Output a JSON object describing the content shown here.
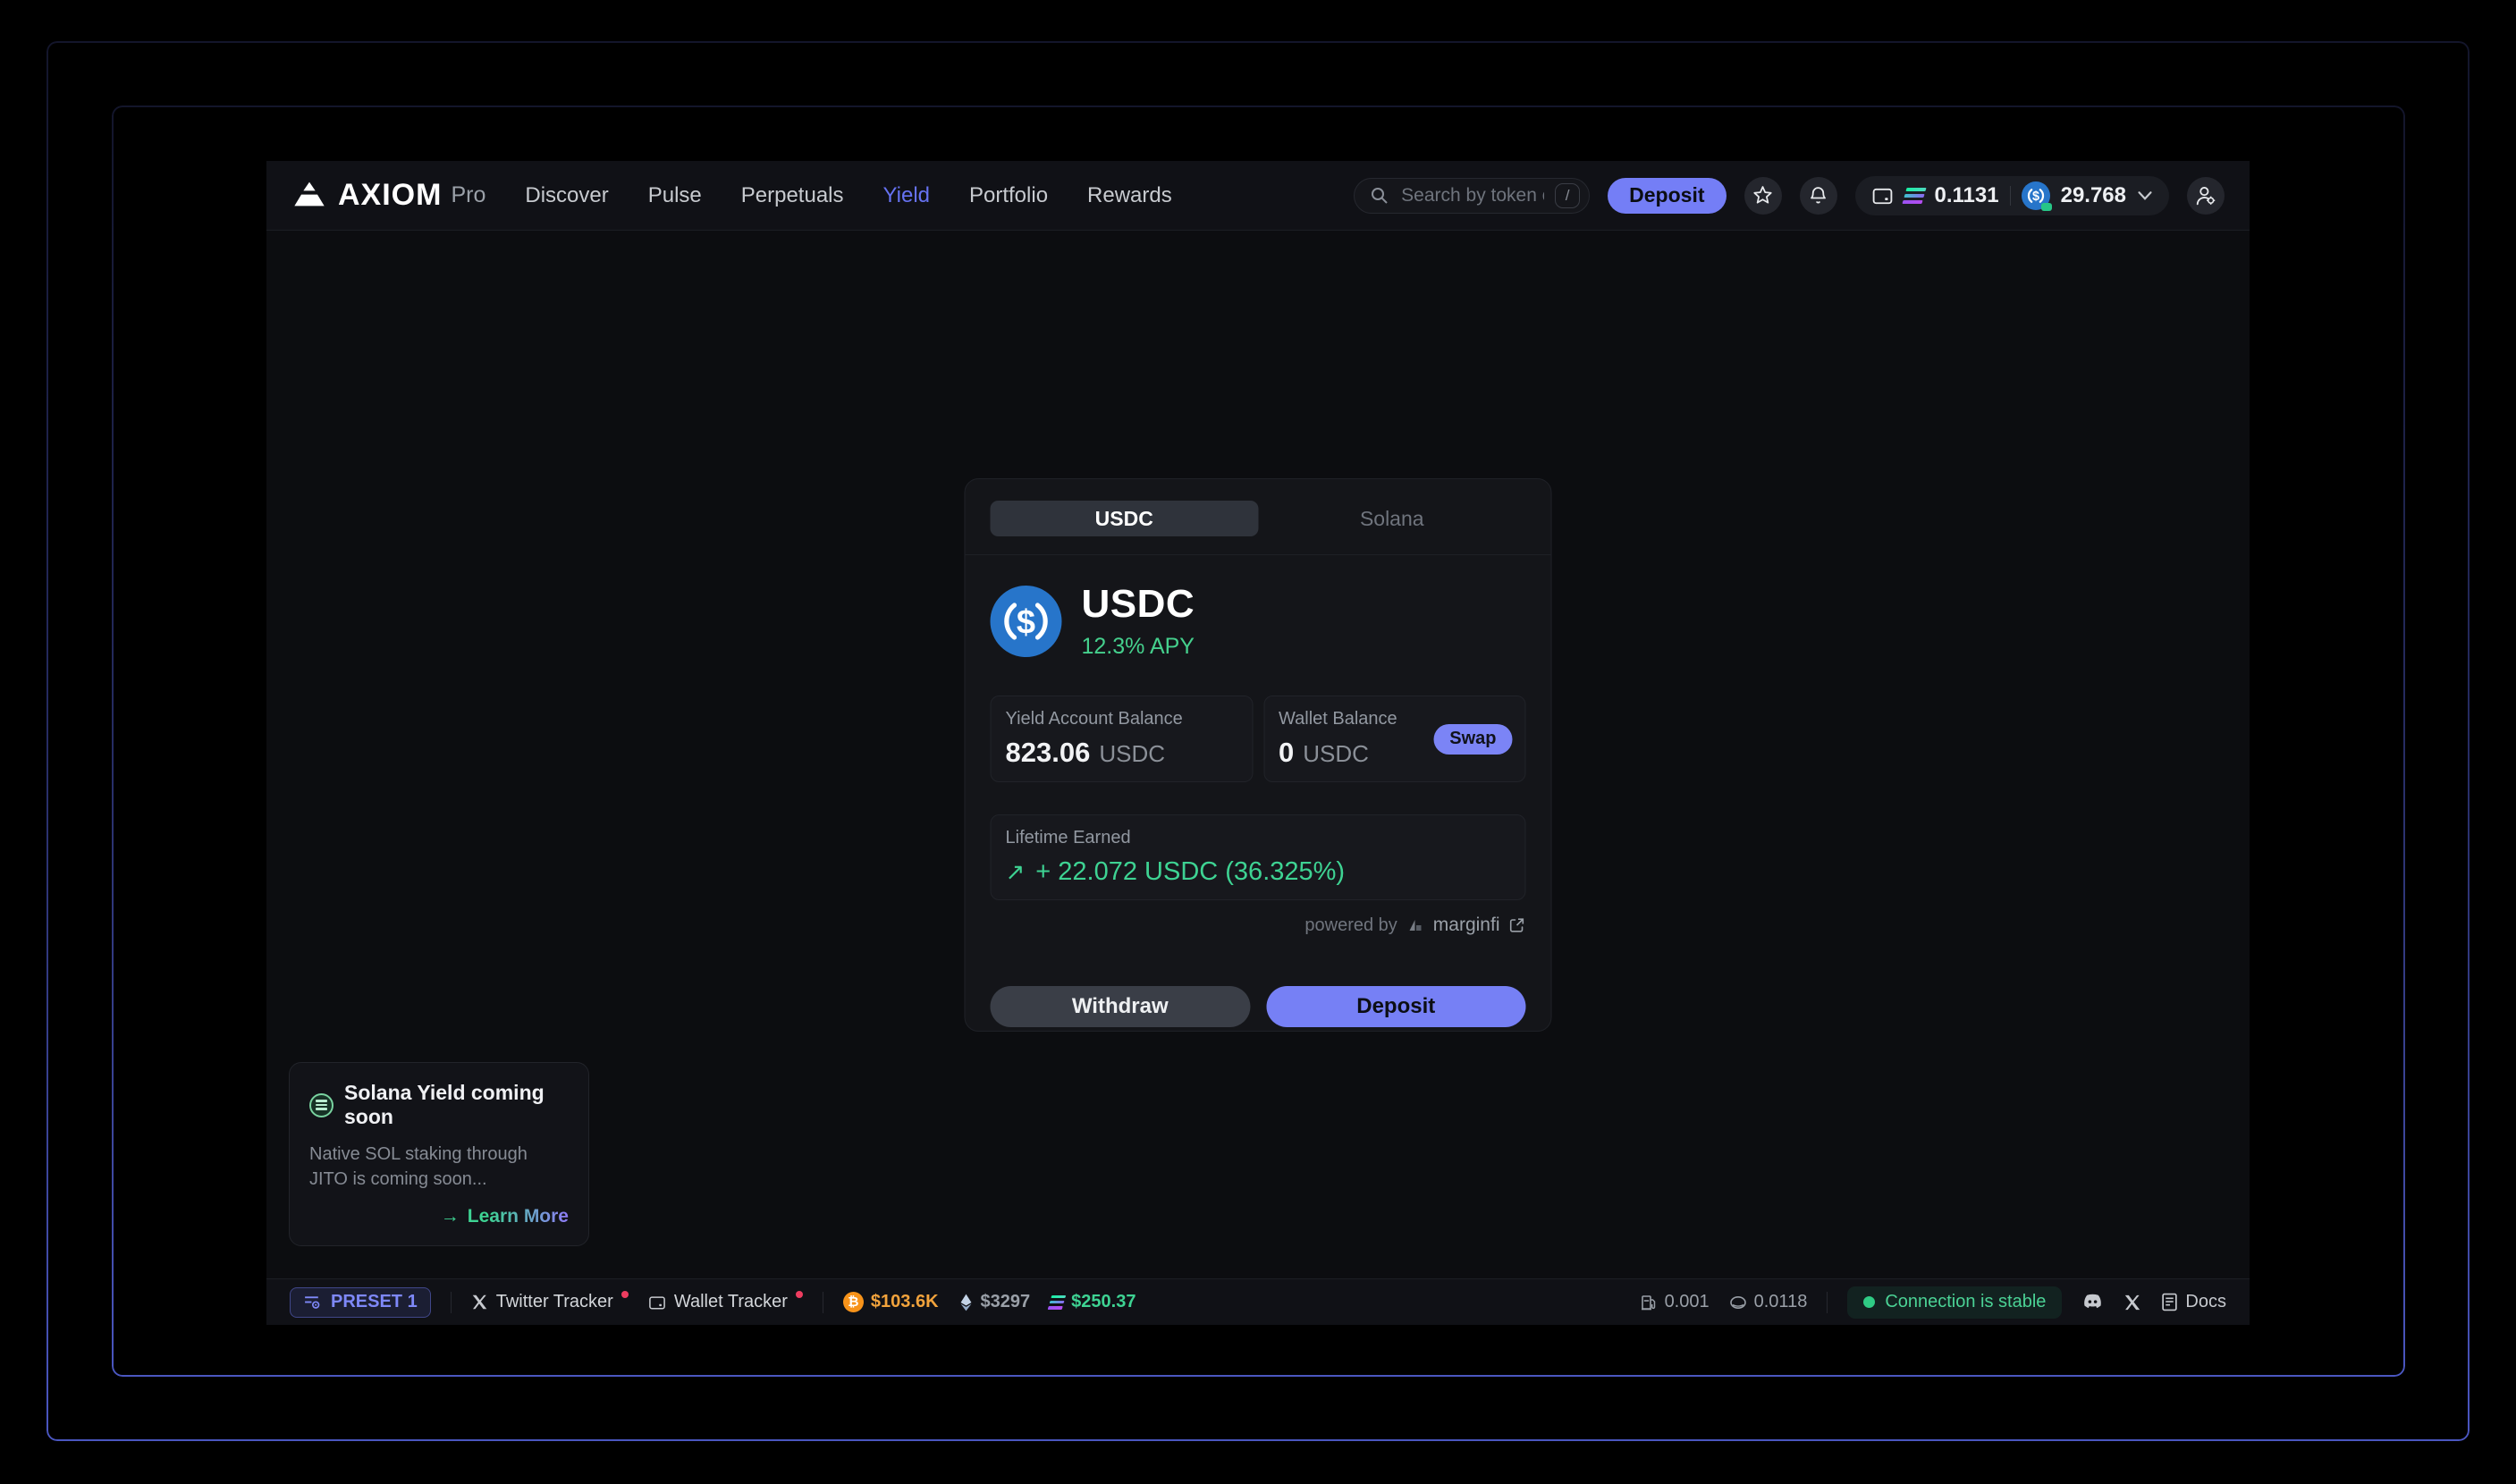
{
  "brand": {
    "name": "AXIOM",
    "suffix": "Pro"
  },
  "nav": {
    "items": [
      {
        "label": "Discover"
      },
      {
        "label": "Pulse"
      },
      {
        "label": "Perpetuals"
      },
      {
        "label": "Yield"
      },
      {
        "label": "Portfolio"
      },
      {
        "label": "Rewards"
      }
    ]
  },
  "topbar": {
    "search_placeholder": "Search by token or CA...",
    "search_key": "/",
    "deposit_label": "Deposit",
    "sol_balance": "0.1131",
    "usdc_balance": "29.768"
  },
  "card": {
    "tabs": [
      {
        "label": "USDC"
      },
      {
        "label": "Solana"
      }
    ],
    "token": "USDC",
    "apy": "12.3% APY",
    "yield_balance": {
      "label": "Yield Account Balance",
      "value": "823.06",
      "unit": "USDC"
    },
    "wallet_balance": {
      "label": "Wallet Balance",
      "value": "0",
      "unit": "USDC"
    },
    "swap_label": "Swap",
    "lifetime": {
      "label": "Lifetime Earned",
      "arrow": "↗",
      "value": "+ 22.072 USDC (36.325%)"
    },
    "powered_by": {
      "prefix": "powered by",
      "provider": "marginfi"
    },
    "withdraw_label": "Withdraw",
    "deposit_label": "Deposit"
  },
  "toast": {
    "title": "Solana Yield coming soon",
    "body": "Native SOL staking through JITO is coming soon...",
    "arrow": "→",
    "cta": "Learn More"
  },
  "statusbar": {
    "preset": "PRESET 1",
    "twitter_tracker": "Twitter Tracker",
    "wallet_tracker": "Wallet Tracker",
    "btc_symbol": "₿",
    "btc_price": "$103.6K",
    "eth_price": "$3297",
    "sol_price": "$250.37",
    "gas": "0.001",
    "priority_fee": "0.0118",
    "connection": "Connection is stable",
    "docs": "Docs"
  },
  "colors": {
    "accent": "#747ef6",
    "green": "#3ed393",
    "orange": "#f7931a",
    "usdc_blue": "#2775ca"
  }
}
